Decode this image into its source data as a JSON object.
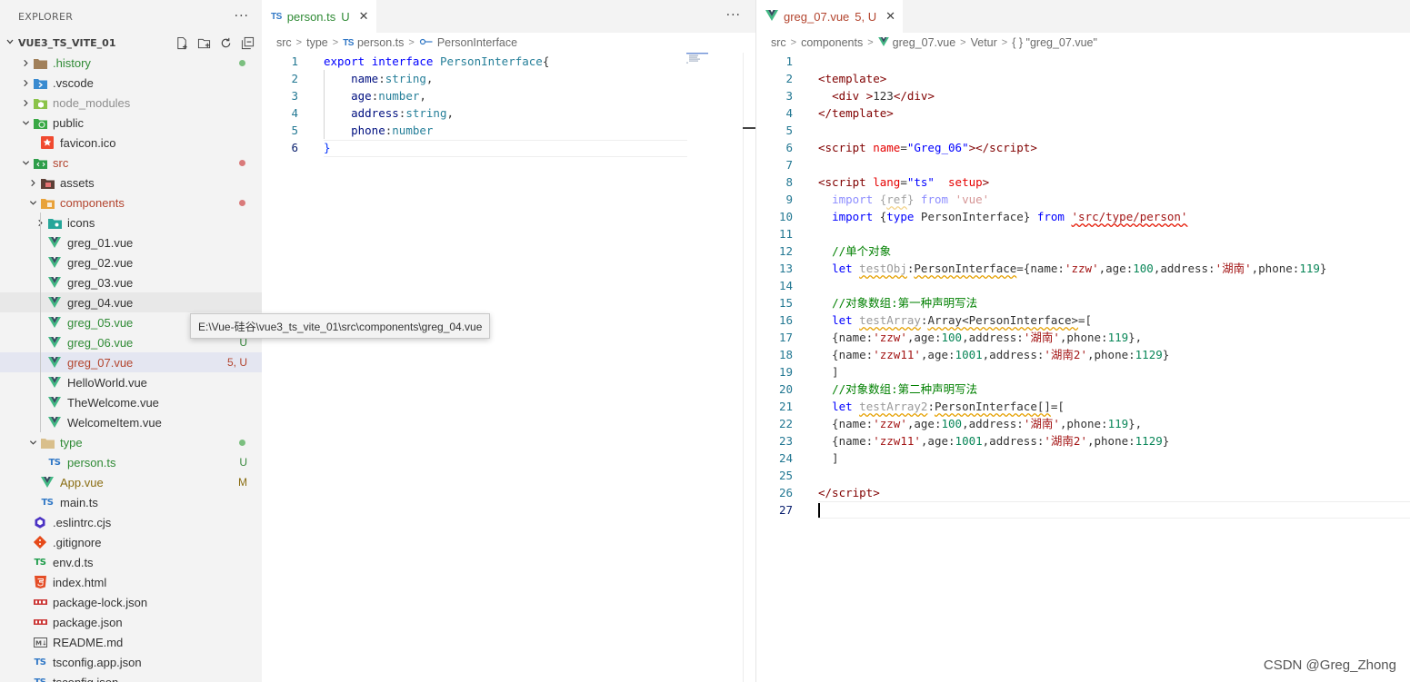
{
  "explorer": {
    "title": "EXPLORER",
    "more": "···",
    "project": "VUE3_TS_VITE_01",
    "tooltip": "E:\\Vue-硅谷\\vue3_ts_vite_01\\src\\components\\greg_04.vue",
    "items": [
      {
        "label": ".history",
        "icon": "history-folder-icon",
        "badge": "dot-green"
      },
      {
        "label": ".vscode",
        "icon": "vscode-folder-icon"
      },
      {
        "label": "node_modules",
        "icon": "node-modules-folder-icon"
      },
      {
        "label": "public",
        "icon": "public-folder-icon"
      },
      {
        "label": "favicon.ico",
        "icon": "favicon-icon"
      },
      {
        "label": "src",
        "icon": "src-folder-icon",
        "badge": "dot-red"
      },
      {
        "label": "assets",
        "icon": "assets-folder-icon"
      },
      {
        "label": "components",
        "icon": "components-folder-icon",
        "badge": "dot-red"
      },
      {
        "label": "icons",
        "icon": "icons-folder-icon"
      },
      {
        "label": "greg_01.vue",
        "icon": "vue-icon"
      },
      {
        "label": "greg_02.vue",
        "icon": "vue-icon"
      },
      {
        "label": "greg_03.vue",
        "icon": "vue-icon"
      },
      {
        "label": "greg_04.vue",
        "icon": "vue-icon"
      },
      {
        "label": "greg_05.vue",
        "icon": "vue-icon",
        "badge": "U"
      },
      {
        "label": "greg_06.vue",
        "icon": "vue-icon",
        "badge": "U"
      },
      {
        "label": "greg_07.vue",
        "icon": "vue-icon",
        "badge": "5, U"
      },
      {
        "label": "HelloWorld.vue",
        "icon": "vue-icon"
      },
      {
        "label": "TheWelcome.vue",
        "icon": "vue-icon"
      },
      {
        "label": "WelcomeItem.vue",
        "icon": "vue-icon"
      },
      {
        "label": "type",
        "icon": "type-folder-icon",
        "badge": "dot-green"
      },
      {
        "label": "person.ts",
        "icon": "typescript-icon",
        "badge": "U"
      },
      {
        "label": "App.vue",
        "icon": "vue-icon",
        "badge": "M"
      },
      {
        "label": "main.ts",
        "icon": "typescript-icon"
      },
      {
        "label": ".eslintrc.cjs",
        "icon": "eslint-icon"
      },
      {
        "label": ".gitignore",
        "icon": "git-icon"
      },
      {
        "label": "env.d.ts",
        "icon": "typescript-def-icon"
      },
      {
        "label": "index.html",
        "icon": "html-icon"
      },
      {
        "label": "package-lock.json",
        "icon": "npm-icon"
      },
      {
        "label": "package.json",
        "icon": "npm-icon"
      },
      {
        "label": "README.md",
        "icon": "markdown-icon"
      },
      {
        "label": "tsconfig.app.json",
        "icon": "tsconfig-icon"
      },
      {
        "label": "tsconfig.json",
        "icon": "tsconfig-icon"
      }
    ]
  },
  "left_editor": {
    "tab": {
      "label": "person.ts",
      "status": "U",
      "icon_text": "TS"
    },
    "more": "···",
    "breadcrumb": [
      "src",
      "type",
      "person.ts",
      "PersonInterface"
    ],
    "line_numbers": [
      "1",
      "2",
      "3",
      "4",
      "5",
      "6"
    ]
  },
  "right_editor": {
    "tab": {
      "label": "greg_07.vue",
      "status": "5, U"
    },
    "breadcrumb": [
      "src",
      "components",
      "greg_07.vue",
      "Vetur",
      "{ } \"greg_07.vue\""
    ],
    "line_numbers": [
      "1",
      "2",
      "3",
      "4",
      "5",
      "6",
      "7",
      "8",
      "9",
      "10",
      "11",
      "12",
      "13",
      "14",
      "15",
      "16",
      "17",
      "18",
      "19",
      "20",
      "21",
      "22",
      "23",
      "24",
      "25",
      "26",
      "27"
    ]
  },
  "watermark": "CSDN @Greg_Zhong",
  "colors": {
    "sidebar_bg": "#f3f3f3",
    "keyword": "#0000ff",
    "tag": "#800000",
    "string": "#a31515",
    "number": "#098658",
    "comment": "#008000"
  }
}
